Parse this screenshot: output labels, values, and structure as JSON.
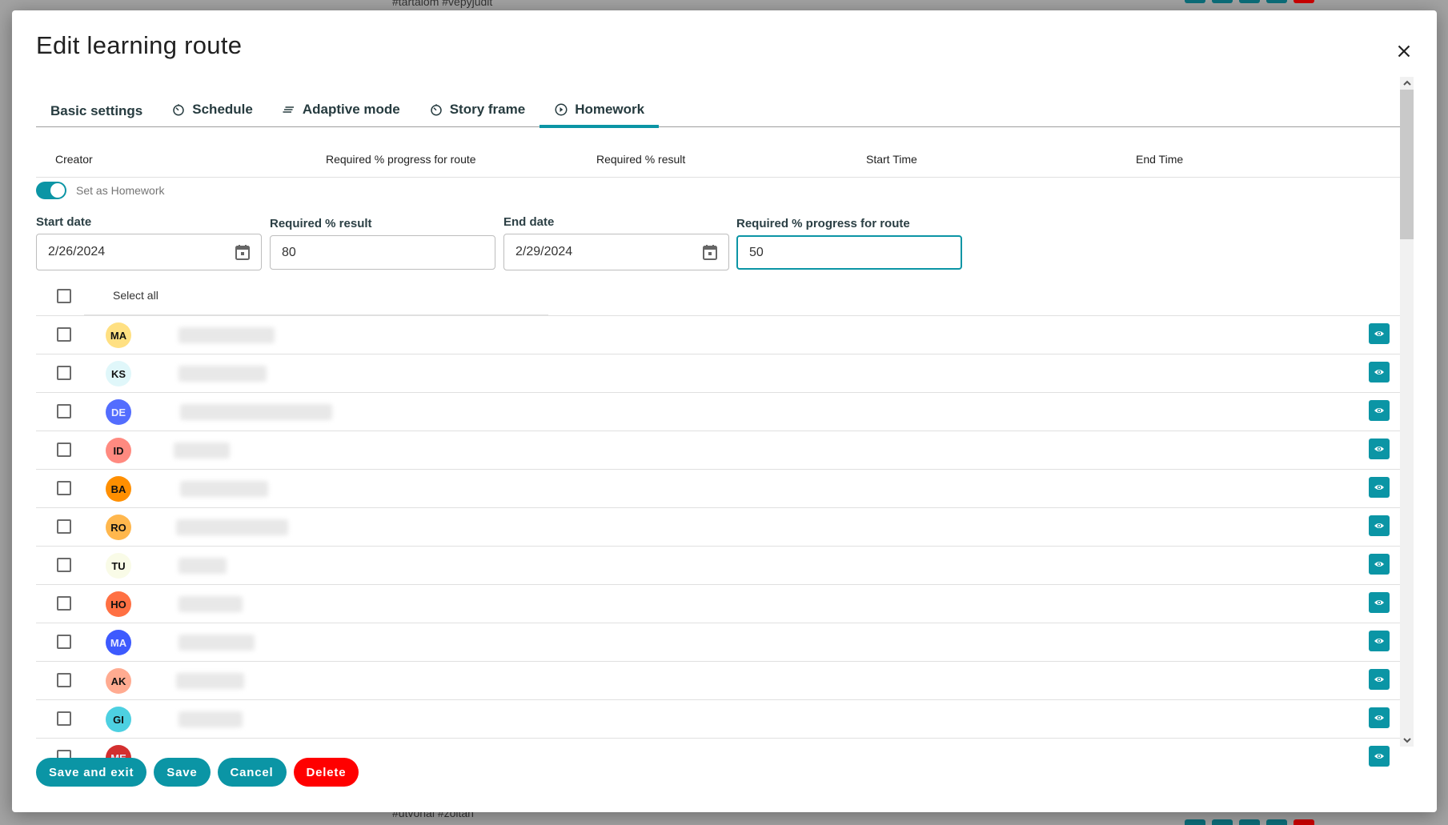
{
  "background": {
    "top_tags": "#tartalom #vepyjudit",
    "bottom_tags": "#utvonal #zoltan"
  },
  "modal": {
    "title": "Edit learning route",
    "close_icon": "close-icon"
  },
  "tabs": [
    {
      "label": "Basic settings",
      "icon": "",
      "active": false
    },
    {
      "label": "Schedule",
      "icon": "timer-icon",
      "active": false
    },
    {
      "label": "Adaptive mode",
      "icon": "lines-icon",
      "active": false
    },
    {
      "label": "Story frame",
      "icon": "timer-icon",
      "active": false
    },
    {
      "label": "Homework",
      "icon": "play-circle-icon",
      "active": true
    }
  ],
  "table_header": {
    "columns": [
      "Creator",
      "Required % progress for route",
      "Required % result",
      "Start Time",
      "End Time"
    ]
  },
  "homework_toggle": {
    "label": "Set as Homework",
    "on": true
  },
  "fields": {
    "start_date": {
      "label": "Start date",
      "value": "2/26/2024"
    },
    "required_result": {
      "label": "Required % result",
      "value": "80"
    },
    "end_date": {
      "label": "End date",
      "value": "2/29/2024"
    },
    "required_progress": {
      "label": "Required % progress for route",
      "value": "50"
    }
  },
  "select_all_label": "Select all",
  "students": [
    {
      "initials": "MA",
      "color": "#ffe082",
      "checked": false
    },
    {
      "initials": "KS",
      "color": "#e0f7fa",
      "checked": false
    },
    {
      "initials": "DE",
      "color": "#536dfe",
      "checked": false
    },
    {
      "initials": "ID",
      "color": "#ff8a80",
      "checked": false
    },
    {
      "initials": "BA",
      "color": "#ff8f00",
      "checked": false
    },
    {
      "initials": "RO",
      "color": "#ffb74d",
      "checked": false
    },
    {
      "initials": "TU",
      "color": "#f9fbe7",
      "checked": false
    },
    {
      "initials": "HO",
      "color": "#ff7043",
      "checked": false
    },
    {
      "initials": "MA",
      "color": "#3d5afe",
      "checked": false
    },
    {
      "initials": "AK",
      "color": "#ffab91",
      "checked": false
    },
    {
      "initials": "GI",
      "color": "#4dd0e1",
      "checked": false
    },
    {
      "initials": "ME",
      "color": "#d32f2f",
      "checked": false
    }
  ],
  "actions": {
    "save_exit": "Save and exit",
    "save": "Save",
    "cancel": "Cancel",
    "delete": "Delete"
  },
  "colors": {
    "accent": "#0b95a5",
    "danger": "#ff0000"
  }
}
